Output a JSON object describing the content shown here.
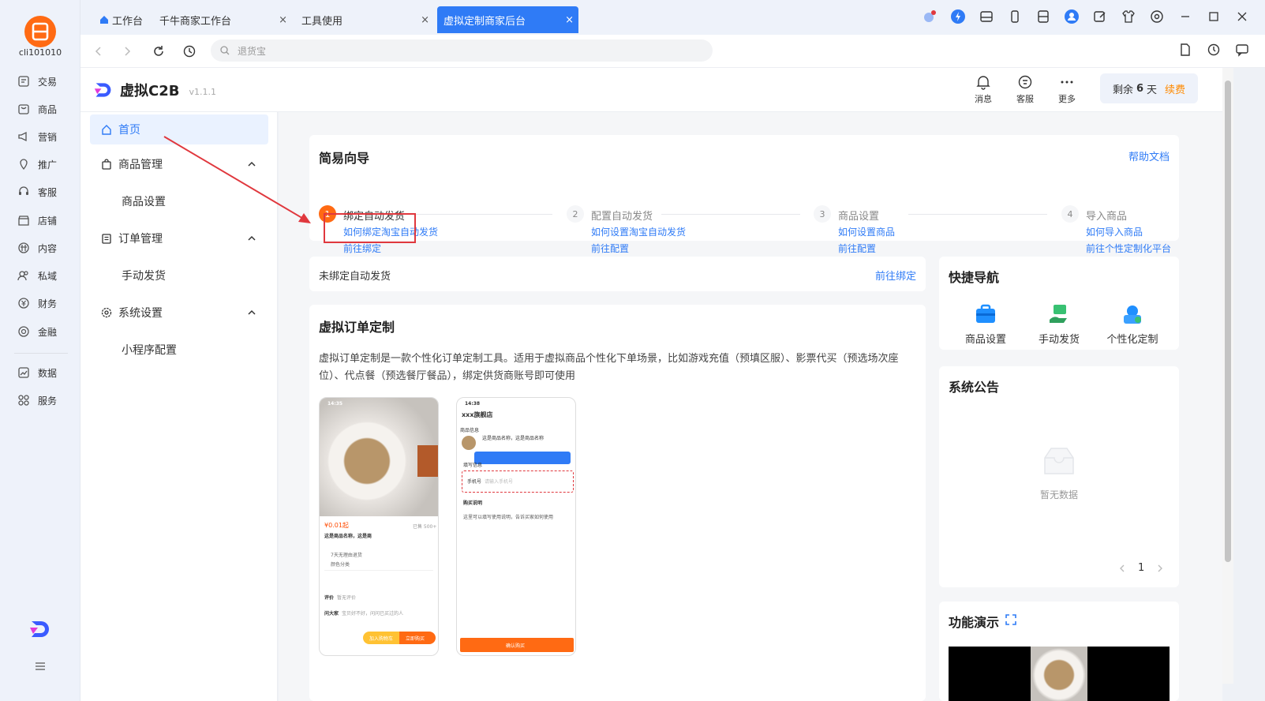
{
  "rail": {
    "username": "cli101010",
    "items": [
      {
        "label": "交易",
        "icon": "trade-icon"
      },
      {
        "label": "商品",
        "icon": "goods-icon"
      },
      {
        "label": "营销",
        "icon": "marketing-icon"
      },
      {
        "label": "推广",
        "icon": "promotion-icon"
      },
      {
        "label": "客服",
        "icon": "service-icon"
      },
      {
        "label": "店铺",
        "icon": "shop-icon"
      },
      {
        "label": "内容",
        "icon": "content-icon"
      },
      {
        "label": "私域",
        "icon": "private-domain-icon"
      },
      {
        "label": "财务",
        "icon": "finance-icon"
      },
      {
        "label": "金融",
        "icon": "banking-icon"
      },
      {
        "label": "数据",
        "icon": "data-icon"
      },
      {
        "label": "服务",
        "icon": "apps-icon"
      }
    ]
  },
  "tabs": {
    "workbench": "工作台",
    "items": [
      {
        "label": "千牛商家工作台"
      },
      {
        "label": "工具使用"
      },
      {
        "label": "虚拟定制商家后台"
      }
    ],
    "close": "×"
  },
  "navbar": {
    "url_placeholder": "退货宝"
  },
  "app": {
    "name": "虚拟C2B",
    "version": "v1.1.1",
    "actions": [
      {
        "label": "消息",
        "icon": "bell-icon"
      },
      {
        "label": "客服",
        "icon": "service-icon"
      },
      {
        "label": "更多",
        "icon": "more-icon"
      }
    ],
    "renew": {
      "prefix": "剩余",
      "days": "6",
      "suffix": "天",
      "link": "续费"
    }
  },
  "menu": {
    "home": "首页",
    "groups": [
      {
        "label": "商品管理",
        "sub": "商品设置"
      },
      {
        "label": "订单管理",
        "sub": "手动发货"
      },
      {
        "label": "系统设置",
        "sub": "小程序配置"
      }
    ]
  },
  "guide": {
    "title": "简易向导",
    "help": "帮助文档",
    "steps": [
      {
        "num": "1",
        "title": "绑定自动发货",
        "link1": "如何绑定淘宝自动发货",
        "link2": "前往绑定"
      },
      {
        "num": "2",
        "title": "配置自动发货",
        "link1": "如何设置淘宝自动发货",
        "link2": "前往配置"
      },
      {
        "num": "3",
        "title": "商品设置",
        "link1": "如何设置商品",
        "link2": "前往配置"
      },
      {
        "num": "4",
        "title": "导入商品",
        "link1": "如何导入商品",
        "link2": "前往个性定制化平台"
      }
    ]
  },
  "bind": {
    "text": "未绑定自动发货",
    "link": "前往绑定"
  },
  "custom": {
    "title": "虚拟订单定制",
    "desc": "虚拟订单定制是一款个性化订单定制工具。适用于虚拟商品个性化下单场景，比如游戏充值（预填区服）、影票代买（预选场次座位）、代点餐（预选餐厅餐品），绑定供货商账号即可使用",
    "phone1": {
      "time": "14:35",
      "price": "¥0.01起",
      "sold": "已售 500+",
      "name": "这是商品名称，这是商",
      "row1": "7天无理由退货",
      "row2": "颜色分类",
      "review": "评价",
      "review_val": "暂无评价",
      "ask": "问大家",
      "ask_val": "宝贝好不好，问问已买过的人",
      "cart": "加入购物车",
      "buy": "立即购买"
    },
    "phone2": {
      "time": "14:38",
      "store": "xxx旗舰店",
      "info": "商品信息",
      "name": "这是商品名称，这是商品名称",
      "fill": "填写信息",
      "phone_label": "手机号",
      "phone_ph": "请输入手机号",
      "notes": "购买说明",
      "notes_text": "这里可以填写使用说明，告诉买家如何使用",
      "confirm": "确认购买"
    }
  },
  "quicknav": {
    "title": "快捷导航",
    "items": [
      {
        "label": "商品设置",
        "icon": "goods-settings-icon"
      },
      {
        "label": "手动发货",
        "icon": "manual-ship-icon"
      },
      {
        "label": "个性化定制",
        "icon": "custom-icon"
      }
    ]
  },
  "notice": {
    "title": "系统公告",
    "empty": "暂无数据",
    "page": "1"
  },
  "demo": {
    "title": "功能演示"
  },
  "colors": {
    "accent": "#2f7bf6",
    "orange": "#ff6a13",
    "annotation": "#e0383e"
  }
}
